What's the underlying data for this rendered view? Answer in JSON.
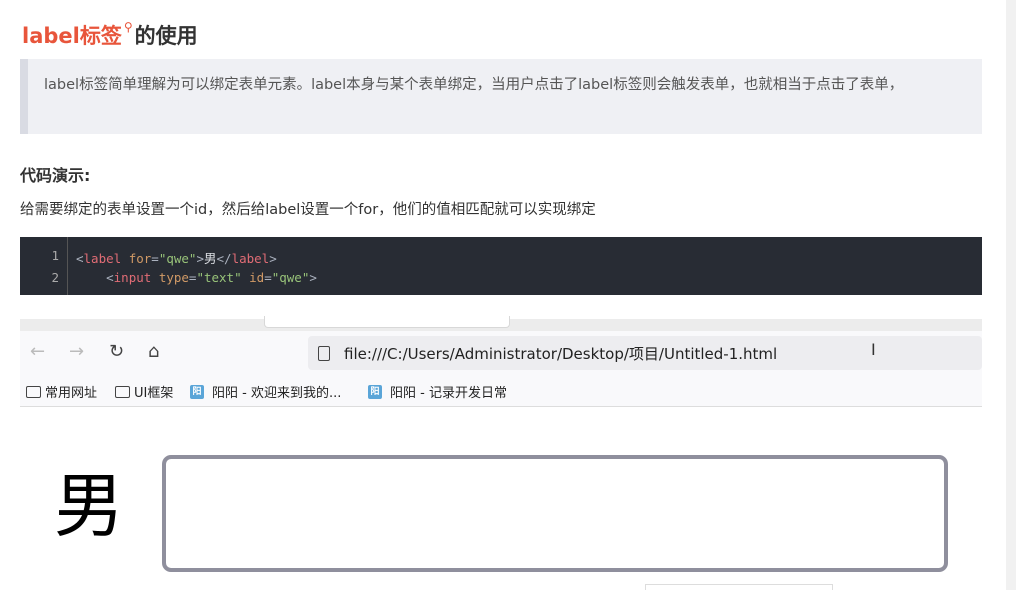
{
  "article": {
    "title_keyword": "label标签",
    "title_icon": "search-icon",
    "title_rest": "的使用",
    "quote": "label标签简单理解为可以绑定表单元素。label本身与某个表单绑定，当用户点击了label标签则会触发表单，也就相当于点击了表单，",
    "subhead": "代码演示:",
    "desc": "给需要绑定的表单设置一个id，然后给label设置一个for，他们的值相匹配就可以实现绑定",
    "code": {
      "line_numbers": [
        "1",
        "2"
      ],
      "line1": {
        "p1": "<",
        "tag1": "label",
        "sp": " ",
        "attr": "for",
        "eq": "=",
        "val": "\"qwe\"",
        "p2": ">",
        "text": "男",
        "p3": "</",
        "tag2": "label",
        "p4": ">"
      },
      "line2": {
        "indent": "    ",
        "p1": "<",
        "tag": "input",
        "sp1": " ",
        "attr1": "type",
        "eq1": "=",
        "val1": "\"text\"",
        "sp2": " ",
        "attr2": "id",
        "eq2": "=",
        "val2": "\"qwe\"",
        "p2": ">"
      }
    }
  },
  "browser": {
    "back_icon": "←",
    "forward_icon": "→",
    "reload_icon": "↻",
    "home_icon": "⌂",
    "url": "file:///C:/Users/Administrator/Desktop/项目/Untitled-1.html",
    "cursor": "I",
    "bookmarks": [
      {
        "label": "常用网址",
        "icon": "folder-icon"
      },
      {
        "label": "UI框架",
        "icon": "folder-icon"
      },
      {
        "label": "阳阳 - 欢迎来到我的...",
        "icon": "site-favicon"
      },
      {
        "label": "阳阳 - 记录开发日常",
        "icon": "site-favicon"
      }
    ],
    "favicon_text": "阳"
  },
  "demo": {
    "label": "男"
  },
  "colors": {
    "accent": "#e8553b",
    "code_bg": "#282c34",
    "quote_bg": "#eff0f4"
  }
}
